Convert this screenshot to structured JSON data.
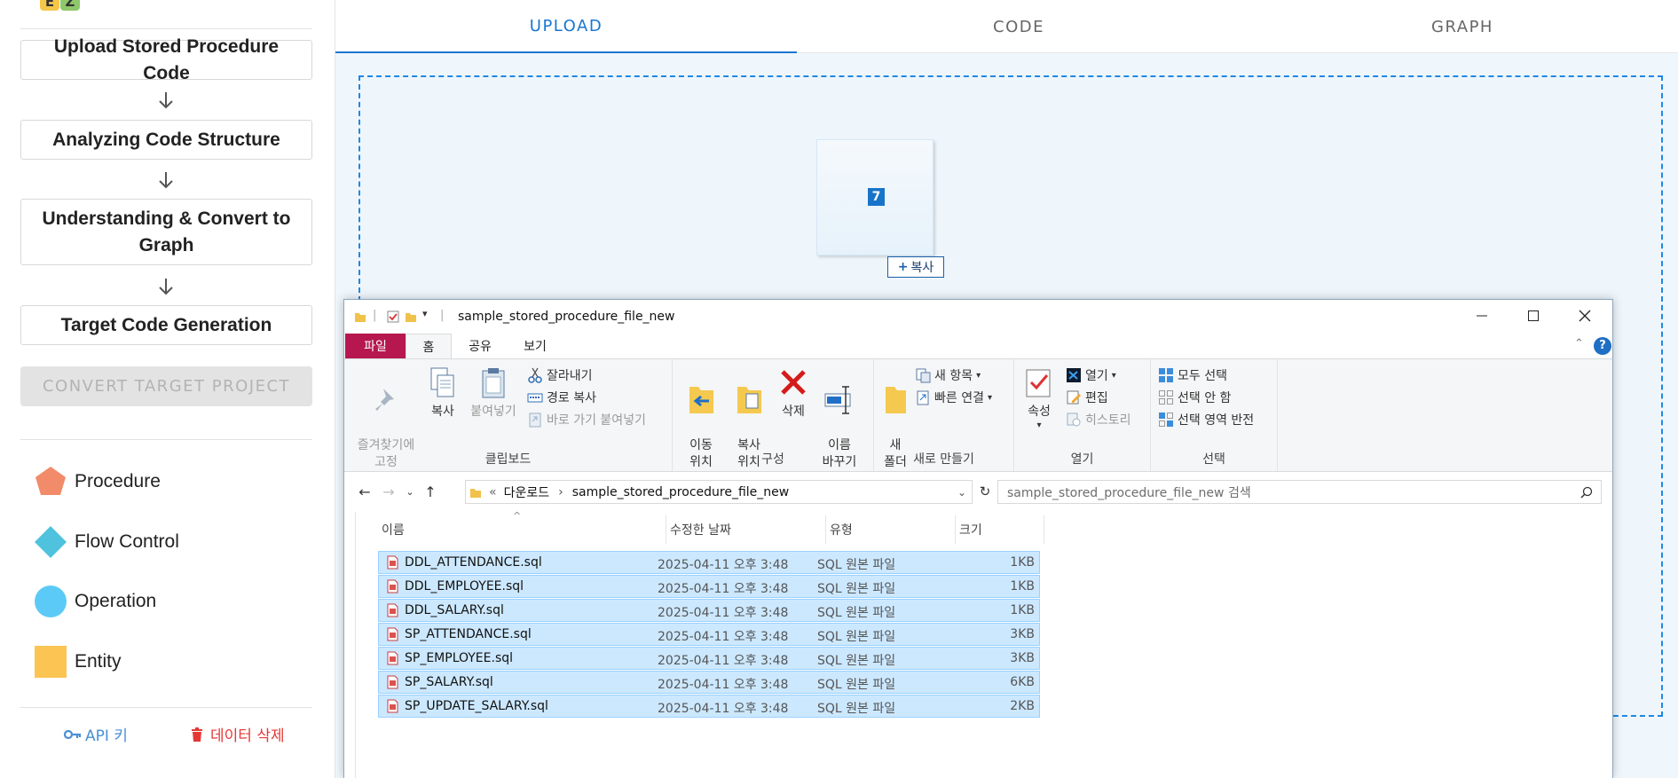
{
  "sidebar": {
    "logo": [
      "E",
      "Z"
    ],
    "steps": [
      "Upload Stored Procedure Code",
      "Analyzing Code Structure",
      "Understanding & Convert to Graph",
      "Target Code Generation"
    ],
    "convert_button": "CONVERT TARGET PROJECT",
    "legend": [
      {
        "label": "Procedure",
        "shape": "pentagon-icon",
        "color": "#f28b6a"
      },
      {
        "label": "Flow Control",
        "shape": "diamond-icon",
        "color": "#4fc3dd"
      },
      {
        "label": "Operation",
        "shape": "circle-icon",
        "color": "#5ccaf7"
      },
      {
        "label": "Entity",
        "shape": "square-icon",
        "color": "#fbc453"
      }
    ],
    "api_key_label": "API 키",
    "delete_data_label": "데이터 삭제"
  },
  "tabs": [
    "UPLOAD",
    "CODE",
    "GRAPH"
  ],
  "active_tab": "UPLOAD",
  "drag": {
    "count": "7",
    "copy_label": "복사"
  },
  "explorer": {
    "title": "sample_stored_procedure_file_new",
    "ribbon_tabs": [
      "파일",
      "홈",
      "공유",
      "보기"
    ],
    "groups": {
      "clipboard": {
        "label": "클립보드",
        "pin": "즐겨찾기에\n고정",
        "copy": "복사",
        "paste": "붙여넣기",
        "cut": "잘라내기",
        "copy_path": "경로 복사",
        "paste_shortcut": "바로 가기 붙여넣기"
      },
      "organize": {
        "label": "구성",
        "move": "이동\n위치",
        "copy_to": "복사\n위치",
        "delete": "삭제",
        "rename": "이름\n바꾸기"
      },
      "new": {
        "label": "새로 만들기",
        "new_folder": "새\n폴더",
        "new_item": "새 항목",
        "easy_access": "빠른 연결"
      },
      "open": {
        "label": "열기",
        "properties": "속성",
        "open": "열기",
        "edit": "편집",
        "history": "히스토리"
      },
      "select": {
        "label": "선택",
        "select_all": "모두 선택",
        "select_none": "선택 안 함",
        "invert": "선택 영역 반전"
      }
    },
    "breadcrumb": [
      "다운로드",
      "sample_stored_procedure_file_new"
    ],
    "breadcrumb_prefix": "«",
    "search_placeholder": "sample_stored_procedure_file_new 검색",
    "columns": [
      "이름",
      "수정한 날짜",
      "유형",
      "크기"
    ],
    "files": [
      {
        "name": "DDL_ATTENDANCE.sql",
        "date": "2025-04-11 오후 3:48",
        "type": "SQL 원본 파일",
        "size": "1KB"
      },
      {
        "name": "DDL_EMPLOYEE.sql",
        "date": "2025-04-11 오후 3:48",
        "type": "SQL 원본 파일",
        "size": "1KB"
      },
      {
        "name": "DDL_SALARY.sql",
        "date": "2025-04-11 오후 3:48",
        "type": "SQL 원본 파일",
        "size": "1KB"
      },
      {
        "name": "SP_ATTENDANCE.sql",
        "date": "2025-04-11 오후 3:48",
        "type": "SQL 원본 파일",
        "size": "3KB"
      },
      {
        "name": "SP_EMPLOYEE.sql",
        "date": "2025-04-11 오후 3:48",
        "type": "SQL 원본 파일",
        "size": "3KB"
      },
      {
        "name": "SP_SALARY.sql",
        "date": "2025-04-11 오후 3:48",
        "type": "SQL 원본 파일",
        "size": "6KB"
      },
      {
        "name": "SP_UPDATE_SALARY.sql",
        "date": "2025-04-11 오후 3:48",
        "type": "SQL 원본 파일",
        "size": "2KB"
      }
    ]
  },
  "colors": {
    "accent": "#1976d2",
    "file_tab": "#b6174e",
    "selection": "#cce8ff",
    "delete": "#e53935"
  }
}
